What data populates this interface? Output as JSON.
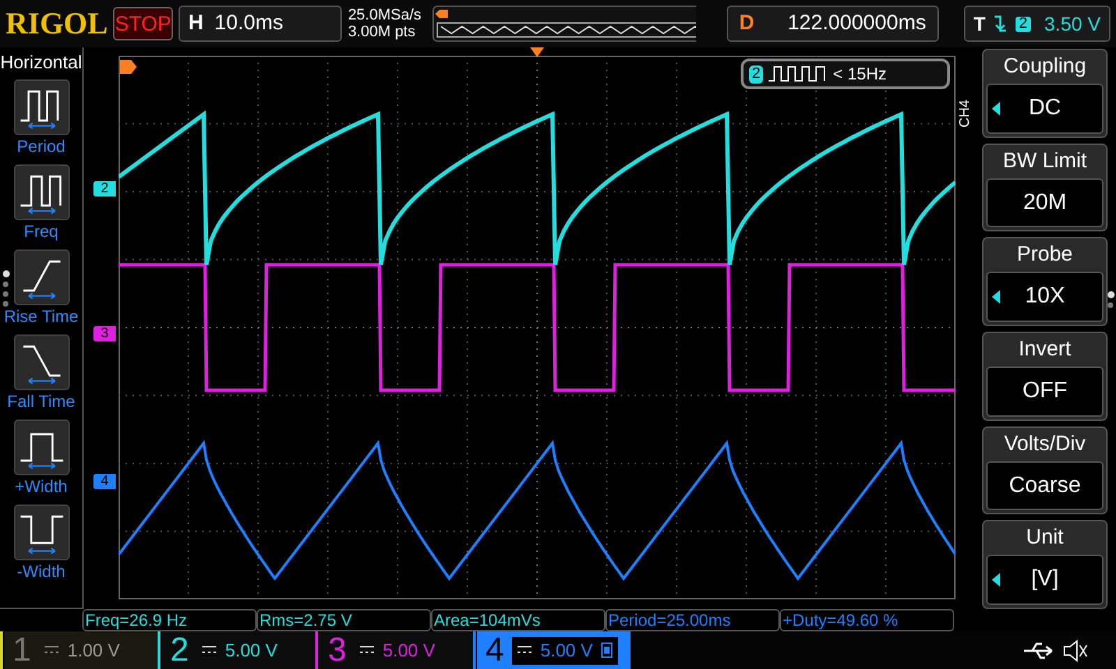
{
  "top_bar": {
    "logo": "RIGOL",
    "run_state": "STOP",
    "horizontal": {
      "label": "H",
      "timebase": "10.0ms",
      "sample_rate": "25.0MSa/s",
      "memory_depth": "3.00M pts"
    },
    "delay": {
      "label": "D",
      "value": "122.000000ms"
    },
    "trigger": {
      "label": "T",
      "source": "2",
      "level": "3.50 V"
    }
  },
  "left_menu": {
    "title": "Horizontal",
    "items": [
      {
        "kind": "period",
        "label": "Period"
      },
      {
        "kind": "freq",
        "label": "Freq"
      },
      {
        "kind": "rise",
        "label": "Rise Time"
      },
      {
        "kind": "fall",
        "label": "Fall Time"
      },
      {
        "kind": "pwidth",
        "label": "+Width"
      },
      {
        "kind": "nwidth",
        "label": "-Width"
      }
    ],
    "pages": [
      {
        "selected": true
      },
      {
        "selected": false
      },
      {
        "selected": false
      },
      {
        "selected": false
      }
    ]
  },
  "scope": {
    "channel_markers": [
      {
        "label": "2",
        "color": "#22dede"
      },
      {
        "label": "3",
        "color": "#e020e0"
      },
      {
        "label": "4",
        "color": "#1e7fff"
      }
    ],
    "trigger_info": {
      "source": "2",
      "condition": "< 15Hz"
    }
  },
  "right_menu": {
    "channel": "CH4",
    "items": [
      {
        "title": "Coupling",
        "value": "DC",
        "adjustable": true
      },
      {
        "title": "BW Limit",
        "value": "20M",
        "adjustable": false
      },
      {
        "title": "Probe",
        "value": "10X",
        "adjustable": true
      },
      {
        "title": "Invert",
        "value": "OFF",
        "adjustable": false
      },
      {
        "title": "Volts/Div",
        "value": "Coarse",
        "adjustable": false
      },
      {
        "title": "Unit",
        "value": "[V]",
        "adjustable": true
      }
    ],
    "pages": [
      {
        "selected": true
      },
      {
        "selected": false
      }
    ]
  },
  "measurements": [
    {
      "text": "Freq=26.9 Hz",
      "color": "#22dede"
    },
    {
      "text": "Rms=2.75 V",
      "color": "#22dede"
    },
    {
      "text": "Area=104mVs",
      "color": "#22dede"
    },
    {
      "text": "Period=25.00ms",
      "color": "#1e7fff"
    },
    {
      "text": "+Duty=49.60 %",
      "color": "#1e7fff"
    }
  ],
  "channels": [
    {
      "number": "1",
      "scale": "1.00 V",
      "enabled": false,
      "selected": false,
      "color": "#d8d820"
    },
    {
      "number": "2",
      "scale": "5.00 V",
      "enabled": true,
      "selected": false,
      "color": "#22dede"
    },
    {
      "number": "3",
      "scale": "5.00 V",
      "enabled": true,
      "selected": false,
      "color": "#e020e0"
    },
    {
      "number": "4",
      "scale": "5.00 V",
      "enabled": true,
      "selected": true,
      "color": "#1e7fff"
    }
  ]
}
